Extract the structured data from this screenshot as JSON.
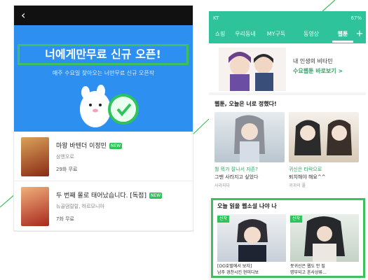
{
  "left_phone": {
    "hero": {
      "title": "너에게만무료 신규 오픈!",
      "subtitle": "매주 수요일 찾아오는 너만무료 신규 오픈작"
    },
    "books": [
      {
        "title": "마왕 바텐더 이정민",
        "badge": "NEW",
        "author": "삼엔오로",
        "meta": "29화 무료",
        "cover_color": "#b5421f"
      },
      {
        "title": "두 번째 몰로 태어났습니다. [독점]",
        "badge": "NEW",
        "author": "뉴골댐랄랄, 하르모니아",
        "meta": "7화 무료",
        "cover_color": "#c73a2a"
      }
    ]
  },
  "right_phone": {
    "status": {
      "left": "KT",
      "right": "67%"
    },
    "tabs": [
      "쇼핑",
      "우리동네",
      "MY구독",
      "동영상",
      "웹툰"
    ],
    "active_tab": "웹툰",
    "plus": "+",
    "banner": {
      "line1": "내 인생의 비타민",
      "line2": "수요웹툰 바로보기 >"
    },
    "section1": {
      "title": "웹툰, 오늘은 너로 정했다!",
      "cards": [
        {
          "title": "뭘 뭐가 잘나서 자존?",
          "subtitle": "그땐 사라지고 싶었다",
          "author": "사라지다"
        },
        {
          "title": "귀신은 타락으로",
          "subtitle": "퇴치해야 해요^^",
          "author": "귀귀의 풀"
        }
      ]
    },
    "section2": {
      "title": "오늘 읽을 웹소설 나야 나",
      "cards": [
        {
          "tag": "신작",
          "line1": "[OO호텔에서 보자]",
          "line2": "남주 경찬시킨 현미디보"
        },
        {
          "tag": "신작",
          "line1": "못귀신은 웹도 안 될",
          "line2": "명부되고 흔사상류..."
        }
      ]
    }
  }
}
